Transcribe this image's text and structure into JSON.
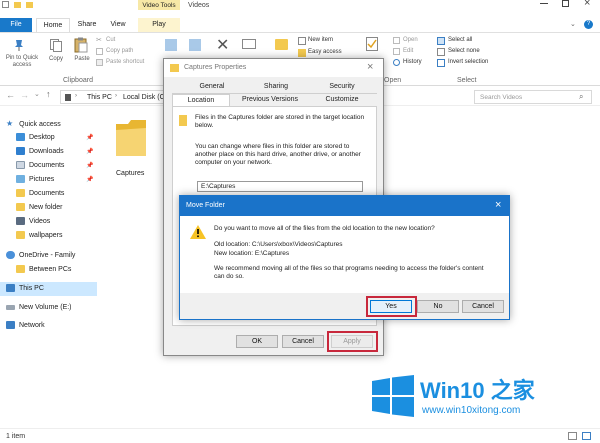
{
  "window": {
    "context_tab": "Video Tools",
    "folder_title": "Videos",
    "tabs": [
      "File",
      "Home",
      "Share",
      "View",
      "Play"
    ]
  },
  "ribbon": {
    "pin": "Pin to Quick access",
    "copy": "Copy",
    "paste": "Paste",
    "cut": "Cut",
    "copy_path": "Copy path",
    "paste_shortcut": "Paste shortcut",
    "clipboard_group": "Clipboard",
    "new_item": "New item",
    "easy_access": "Easy access",
    "open": "Open",
    "edit": "Edit",
    "history": "History",
    "open_group": "Open",
    "select_all": "Select all",
    "select_none": "Select none",
    "invert_selection": "Invert selection",
    "select_group": "Select"
  },
  "address": {
    "this_pc": "This PC",
    "local_disk": "Local Disk (C",
    "search_placeholder": "Search Videos"
  },
  "sidebar": {
    "quick_access": "Quick access",
    "items": [
      "Desktop",
      "Downloads",
      "Documents",
      "Pictures",
      "Documents",
      "New folder",
      "Videos",
      "wallpapers"
    ],
    "onedrive": "OneDrive - Family",
    "between_pcs": "Between PCs",
    "this_pc": "This PC",
    "new_volume": "New Volume (E:)",
    "network": "Network"
  },
  "content": {
    "folder_name": "Captures"
  },
  "status": {
    "items": "1 item"
  },
  "properties": {
    "title": "Captures Properties",
    "tabs_row1": [
      "General",
      "Sharing",
      "Security"
    ],
    "tabs_row2": [
      "Location",
      "Previous Versions",
      "Customize"
    ],
    "text1": "Files in the Captures folder are stored in the target location below.",
    "text2": "You can change where files in this folder are stored to another place on this hard drive, another drive, or another computer on your network.",
    "path": "E:\\Captures",
    "ok": "OK",
    "cancel": "Cancel",
    "apply": "Apply"
  },
  "move_dialog": {
    "title": "Move Folder",
    "question": "Do you want to move all of the files from the old location to the new location?",
    "old_location": "Old location: C:\\Users\\xbox\\Videos\\Captures",
    "new_location": "New location: E:\\Captures",
    "recommend": "We recommend moving all of the files so that programs needing to access the folder's content can do so.",
    "yes": "Yes",
    "no": "No",
    "cancel": "Cancel"
  },
  "watermark": {
    "brand": "Win10 之家",
    "url": "www.win10xitong.com"
  },
  "colors": {
    "accent": "#1979ca",
    "dialog_title_active": "#1a73c9",
    "highlight": "#c8283c",
    "folder": "#f3c94f"
  }
}
